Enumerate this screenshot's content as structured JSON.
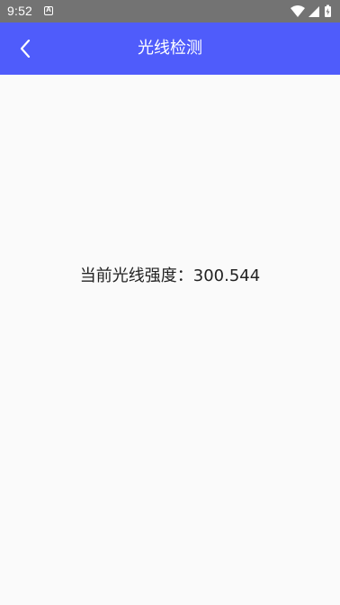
{
  "status_bar": {
    "time": "9:52",
    "notification_icon": "a-icon",
    "icons": [
      "wifi-icon",
      "signal-icon",
      "battery-icon"
    ]
  },
  "app_bar": {
    "title": "光线检测",
    "back_icon": "chevron-left-icon",
    "background": "#4f5cfb"
  },
  "main": {
    "light_label": "当前光线强度：",
    "light_value": "300.544"
  }
}
